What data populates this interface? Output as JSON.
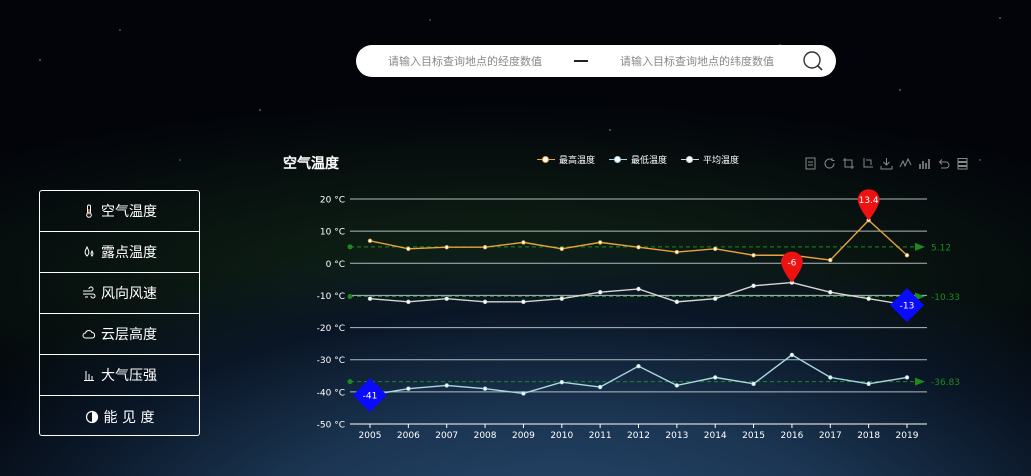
{
  "search": {
    "lon_placeholder": "请输入目标查询地点的经度数值",
    "lat_placeholder": "请输入目标查询地点的纬度数值",
    "icon": "search-icon"
  },
  "menu": {
    "items": [
      {
        "label": "空气温度",
        "icon": "thermometer-icon"
      },
      {
        "label": "露点温度",
        "icon": "dewpoint-icon"
      },
      {
        "label": "风向风速",
        "icon": "wind-icon"
      },
      {
        "label": "云层高度",
        "icon": "cloud-icon"
      },
      {
        "label": "大气压强",
        "icon": "pressure-icon"
      },
      {
        "label": "能 见 度",
        "icon": "visibility-icon"
      }
    ]
  },
  "toolbox": [
    "data-view-icon",
    "restore-icon",
    "zoom-icon",
    "zoom-reset-icon",
    "download-icon",
    "line-icon",
    "bar-icon",
    "undo-icon",
    "stack-icon"
  ],
  "colors": {
    "max": "#e8a33c",
    "min": "#d6d6d6",
    "avg": "#a8d8e0",
    "markpoint_max": "#ee1111",
    "markpoint_min": "#0a0aff",
    "markline": "#1e8a1e"
  },
  "chart_data": {
    "type": "line",
    "title": "空气温度",
    "categories": [
      "2005",
      "2006",
      "2007",
      "2008",
      "2009",
      "2010",
      "2011",
      "2012",
      "2013",
      "2014",
      "2015",
      "2016",
      "2017",
      "2018",
      "2019"
    ],
    "ylim": [
      -50,
      20
    ],
    "yticks": [
      20,
      10,
      0,
      -10,
      -20,
      -30,
      -40,
      -50
    ],
    "yunit": "°C",
    "legend_position": "top-center",
    "series": [
      {
        "name": "最高温度",
        "values": [
          7,
          4.5,
          5,
          5,
          6.5,
          4.5,
          6.5,
          5,
          3.5,
          4.5,
          2.5,
          2.5,
          1,
          13.4,
          2.5
        ],
        "markPoint": {
          "label": "13.4",
          "index": 13,
          "kind": "max"
        },
        "markLine": "5.12"
      },
      {
        "name": "最低温度",
        "values": [
          -11,
          -12,
          -11,
          -12,
          -12,
          -11,
          -9,
          -8,
          -12,
          -11,
          -7,
          -6,
          -9,
          -11,
          -13
        ],
        "markPoint": [
          {
            "label": "-6",
            "index": 11,
            "kind": "max"
          },
          {
            "label": "-13",
            "index": 14,
            "kind": "min"
          }
        ],
        "markLine": "-10.33"
      },
      {
        "name": "平均温度",
        "values": [
          -41,
          -39,
          -38,
          -39,
          -40.5,
          -37,
          -38.5,
          -32,
          -38,
          -35.5,
          -37.5,
          -28.5,
          -35.5,
          -37.5,
          -35.5
        ],
        "markPoint": {
          "label": "-41",
          "index": 0,
          "kind": "min"
        },
        "markLine": "-36.83"
      }
    ],
    "markline_values": [
      5.12,
      -10.33,
      -36.83
    ]
  }
}
